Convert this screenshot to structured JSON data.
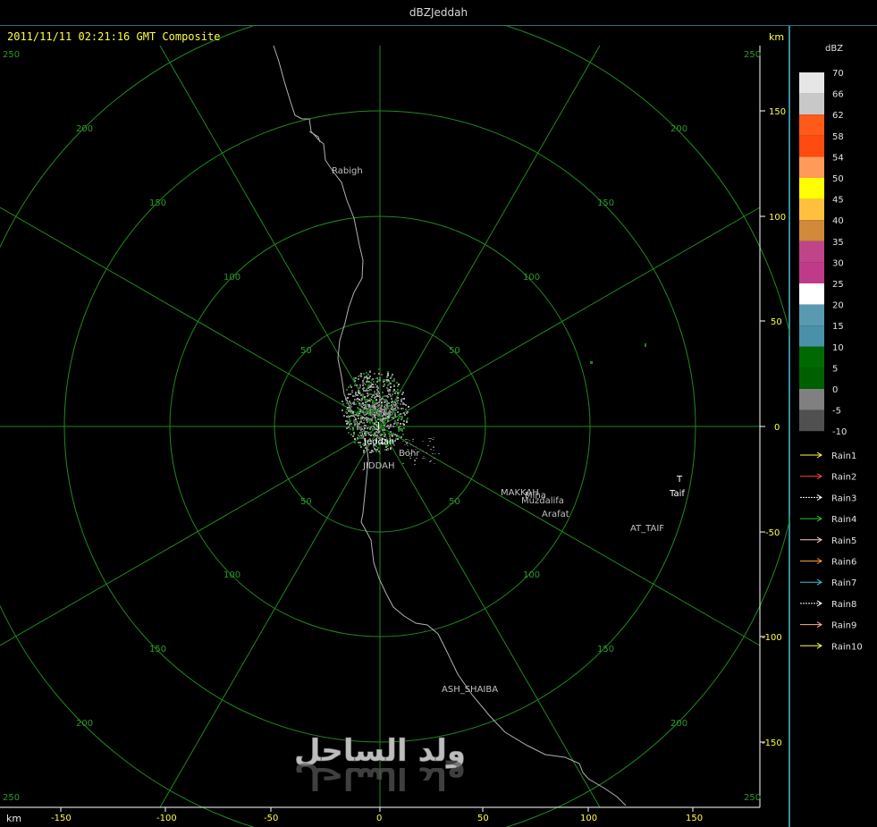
{
  "window": {
    "title": "dBZJeddah"
  },
  "header": {
    "timestamp": "2011/11/11 02:21:16 GMT Composite",
    "unit_km_top": "km",
    "unit_km_bottom": "km"
  },
  "y_axis": {
    "ticks": [
      "150",
      "100",
      "50",
      "0",
      "-50",
      "-100",
      "-150"
    ],
    "corner_top": "250",
    "corner_bottom": "250"
  },
  "x_axis": {
    "ticks": [
      "-150",
      "-100",
      "-50",
      "0",
      "50",
      "100",
      "150"
    ],
    "corner_left": "250",
    "corner_right": "250",
    "corner_top_left": "250"
  },
  "rings": {
    "labels": [
      "50",
      "100",
      "150",
      "200"
    ]
  },
  "places": {
    "rabigh": "Rabigh",
    "jeddah": "Jeddah",
    "jeddah_marker": "J",
    "jiddah": "JIDDAH",
    "bohr": "Bohr",
    "makkah": "MAKKAH",
    "mina": "Mina",
    "muzdalifa": "Muzdalifa",
    "arafat": "Arafat",
    "taif": "Taif",
    "taif_marker": "T",
    "at_taif": "AT_TAIF",
    "ash_shaiba": "ASH_SHAIBA"
  },
  "watermark": "ولد الساحل",
  "legend": {
    "title": "dBZ",
    "scale": [
      {
        "label": "70",
        "color": "#e6e6e6"
      },
      {
        "label": "66",
        "color": "#c8c8c8"
      },
      {
        "label": "62",
        "color": "#ff5a1a"
      },
      {
        "label": "58",
        "color": "#ff4a10"
      },
      {
        "label": "54",
        "color": "#ff9a5a"
      },
      {
        "label": "50",
        "color": "#ffff00"
      },
      {
        "label": "45",
        "color": "#ffc040"
      },
      {
        "label": "40",
        "color": "#d08a3a"
      },
      {
        "label": "35",
        "color": "#c0448a"
      },
      {
        "label": "30",
        "color": "#c03a8a"
      },
      {
        "label": "25",
        "color": "#ffffff"
      },
      {
        "label": "20",
        "color": "#5a9ab0"
      },
      {
        "label": "15",
        "color": "#4a90a8"
      },
      {
        "label": "10",
        "color": "#006a00"
      },
      {
        "label": "5",
        "color": "#006000"
      },
      {
        "label": "0",
        "color": "#808080"
      },
      {
        "label": "-5",
        "color": "#505050"
      },
      {
        "label": "-10",
        "color": ""
      }
    ],
    "rain": [
      {
        "label": "Rain1",
        "color": "#ffff40"
      },
      {
        "label": "Rain2",
        "color": "#ff4a2a"
      },
      {
        "label": "Rain3",
        "color": "#ffffff"
      },
      {
        "label": "Rain4",
        "color": "#30c030"
      },
      {
        "label": "Rain5",
        "color": "#ffc8c8"
      },
      {
        "label": "Rain6",
        "color": "#ff9a4a"
      },
      {
        "label": "Rain7",
        "color": "#40c0d0"
      },
      {
        "label": "Rain8",
        "color": "#ffffff"
      },
      {
        "label": "Rain9",
        "color": "#ffb0a0"
      },
      {
        "label": "Rain10",
        "color": "#ffff40"
      }
    ]
  }
}
